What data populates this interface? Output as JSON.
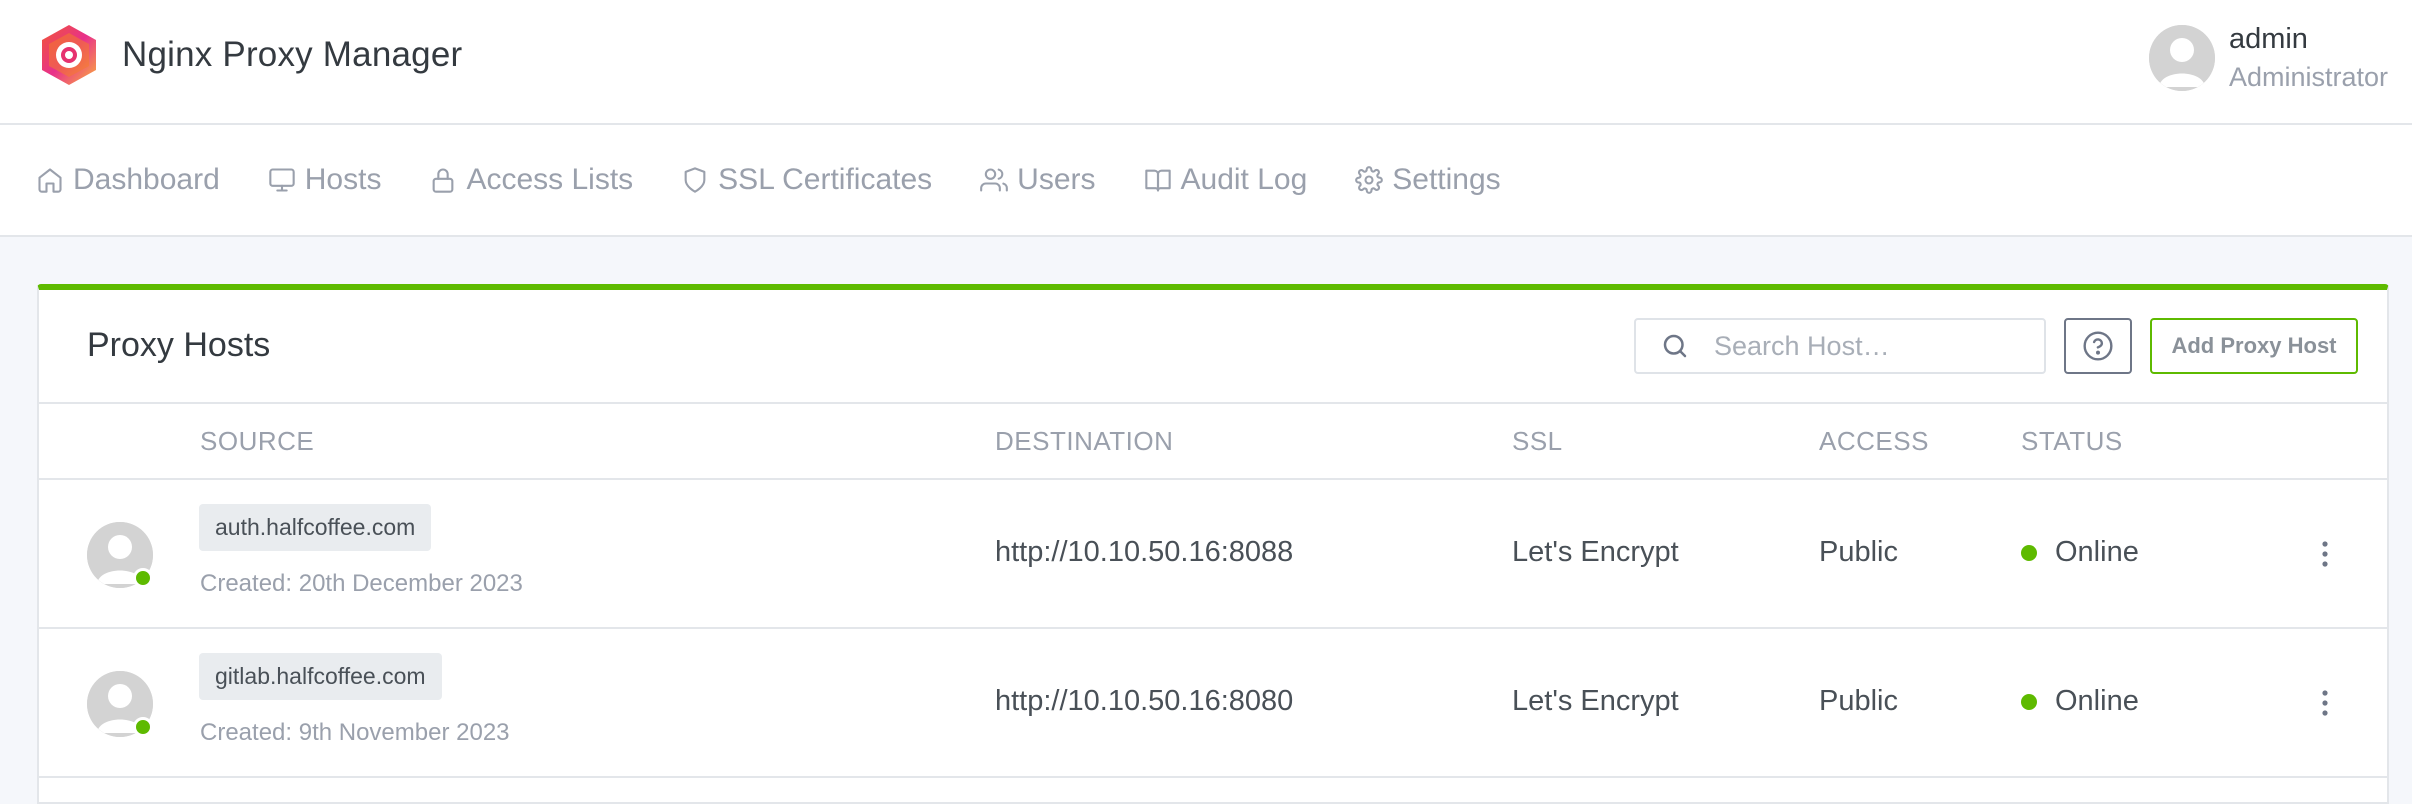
{
  "app": {
    "title": "Nginx Proxy Manager",
    "logo_icon": "nginx-proxy-manager-logo"
  },
  "user": {
    "name": "admin",
    "role": "Administrator"
  },
  "nav": {
    "items": [
      {
        "label": "Dashboard",
        "icon": "home-icon"
      },
      {
        "label": "Hosts",
        "icon": "monitor-icon"
      },
      {
        "label": "Access Lists",
        "icon": "lock-icon"
      },
      {
        "label": "SSL Certificates",
        "icon": "shield-icon"
      },
      {
        "label": "Users",
        "icon": "users-icon"
      },
      {
        "label": "Audit Log",
        "icon": "book-icon"
      },
      {
        "label": "Settings",
        "icon": "gear-icon"
      }
    ]
  },
  "card": {
    "title": "Proxy Hosts",
    "search_placeholder": "Search Host…",
    "add_label": "Add Proxy Host",
    "accent_color": "#5eba00"
  },
  "table": {
    "columns": {
      "source": "SOURCE",
      "destination": "DESTINATION",
      "ssl": "SSL",
      "access": "ACCESS",
      "status": "STATUS"
    },
    "rows": [
      {
        "domain": "auth.halfcoffee.com",
        "created": "Created: 20th December 2023",
        "destination": "http://10.10.50.16:8088",
        "ssl": "Let's Encrypt",
        "access": "Public",
        "status": "Online"
      },
      {
        "domain": "gitlab.halfcoffee.com",
        "created": "Created: 9th November 2023",
        "destination": "http://10.10.50.16:8080",
        "ssl": "Let's Encrypt",
        "access": "Public",
        "status": "Online"
      }
    ]
  }
}
